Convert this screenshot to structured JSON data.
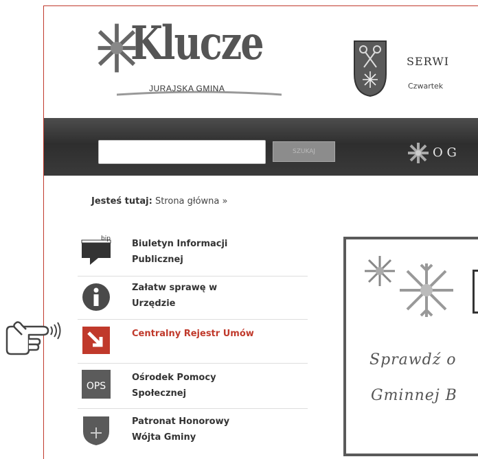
{
  "header": {
    "logo_title": "Klucze",
    "logo_subtitle": "JURAJSKA GMINA",
    "service_title": "Serwi",
    "date_text": "Czwartek"
  },
  "search": {
    "placeholder": "",
    "button_label": "SZUKAJ"
  },
  "nav": {
    "items": [
      {
        "label": "O G"
      }
    ]
  },
  "breadcrumb": {
    "prefix": "Jesteś tutaj:",
    "current": "Strona główna »"
  },
  "sidebar": {
    "items": [
      {
        "label_line1": "Biuletyn Informacji",
        "label_line2": "Publicznej",
        "icon": "bip-icon"
      },
      {
        "label_line1": "Załatw sprawę w",
        "label_line2": "Urzędzie",
        "icon": "info-icon"
      },
      {
        "label_line1": "Centralny Rejestr Umów",
        "label_line2": "",
        "icon": "register-icon"
      },
      {
        "label_line1": "Ośrodek Pomocy",
        "label_line2": "Społecznej",
        "icon": "ops-icon",
        "icon_text": "OPS"
      },
      {
        "label_line1": "Patronat Honorowy",
        "label_line2": "Wójta Gminy",
        "icon": "patronage-icon"
      }
    ]
  },
  "banner": {
    "line1": "Sprawdź o",
    "line2": "Gminnej B"
  },
  "colors": {
    "accent_red": "#c0392b",
    "nav_dark": "#3a3a3a"
  }
}
